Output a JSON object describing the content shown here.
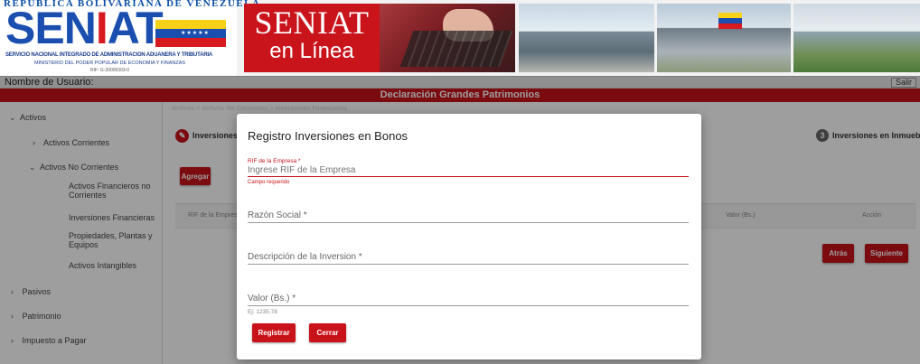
{
  "banner": {
    "logo_top": "REPUBLICA BOLIVARIANA DE VENEZUELA",
    "logo_blue": "SEN",
    "logo_red": "I",
    "logo_rest": "AT",
    "logo_sub1": "SERVICIO NACIONAL INTEGRADO DE ADMINISTRACION ADUANERA Y TRIBUTARIA",
    "logo_sub2": "MINISTERIO DEL PODER POPULAR DE ECONOMIA Y FINANZAS",
    "logo_sub3": "RIF: G-20000303-0",
    "enlinea_line1": "SENIAT",
    "enlinea_line2": "en Línea"
  },
  "userbar": {
    "label": "Nombre de Usuario:",
    "logout": "Salir"
  },
  "page_title": "Declaración Grandes Patrimonios",
  "sidebar": {
    "activos": "Activos",
    "activos_corrientes": "Activos Corrientes",
    "activos_no_corrientes": "Activos No Corrientes",
    "activos_financieros_l1": "Activos Financieros no",
    "activos_financieros_l2": "Corrientes",
    "inversiones_financieras": "Inversiones Financieras",
    "propiedades_l1": "Propiedades, Plantas y",
    "propiedades_l2": "Equipos",
    "activos_intangibles": "Activos Intangibles",
    "pasivos": "Pasivos",
    "patrimonio": "Patrimonio",
    "impuesto": "Impuesto a Pagar"
  },
  "main": {
    "breadcrumb": "Activos > Activos No Corrientes > Inversiones Financieras",
    "step1": "Inversiones e",
    "step3_num": "3",
    "step3": "Inversiones en Inmuebles",
    "add_button": "Agregar",
    "table_headers": {
      "rif": "RIF de la Empresa",
      "valor": "Valor (Bs.)",
      "accion": "Acción"
    },
    "back_button": "Atrás",
    "next_button": "Siguiente"
  },
  "modal": {
    "title": "Registro Inversiones en Bonos",
    "rif_label": "RIF de la Empresa *",
    "rif_placeholder": "Ingrese RIF de la Empresa",
    "rif_error": "Campo requerido",
    "razon_placeholder": "Razón Social *",
    "descripcion_placeholder": "Descripción de la Inversion *",
    "valor_placeholder": "Valor (Bs.) *",
    "valor_hint": "Ej: 1235.78",
    "register_button": "Registrar",
    "close_button": "Cerrar"
  },
  "colors": {
    "brand_red": "#c8131b",
    "brand_blue": "#1a4fb0"
  }
}
